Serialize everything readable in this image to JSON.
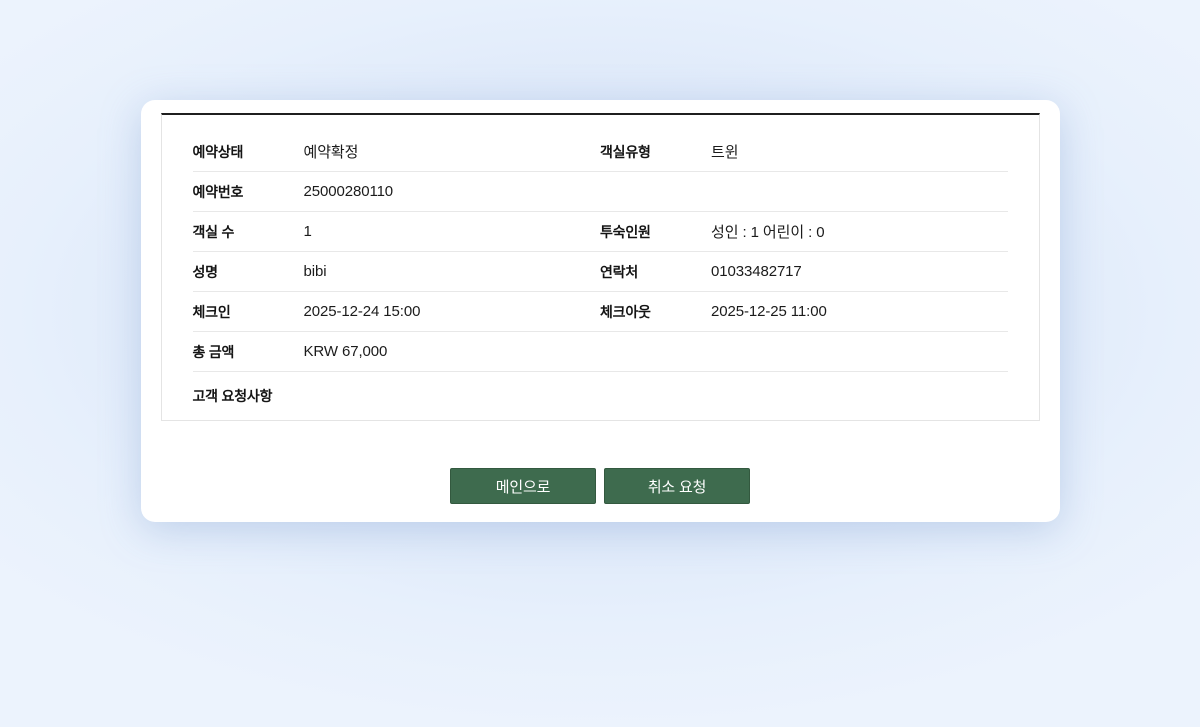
{
  "colors": {
    "background": "#e7f0fc",
    "background_glow": "#d4e2f5",
    "card": "#ffffff",
    "table_top_border": "#1f1f1f",
    "divider": "#e8e8e8",
    "button_green": "#3e6b4e",
    "button_text": "#ffffff"
  },
  "reservation": {
    "rows": [
      {
        "cells": [
          {
            "label": "예약상태",
            "value": "예약확정"
          },
          {
            "label": "객실유형",
            "value": "트윈"
          }
        ]
      },
      {
        "cells": [
          {
            "label": "예약번호",
            "value": "25000280110"
          }
        ]
      },
      {
        "cells": [
          {
            "label": "객실 수",
            "value": "1"
          },
          {
            "label": "투숙인원",
            "value": "성인 : 1 어린이 : 0"
          }
        ]
      },
      {
        "cells": [
          {
            "label": "성명",
            "value": "bibi"
          },
          {
            "label": "연락처",
            "value": "01033482717"
          }
        ]
      },
      {
        "cells": [
          {
            "label": "체크인",
            "value": "2025-12-24 15:00"
          },
          {
            "label": "체크아웃",
            "value": "2025-12-25 11:00"
          }
        ]
      },
      {
        "cells": [
          {
            "label": "총 금액",
            "value": "KRW 67,000"
          }
        ]
      },
      {
        "cells": [
          {
            "label": "고객 요청사항",
            "value": ""
          }
        ]
      }
    ],
    "buttons": {
      "main": "메인으로",
      "cancel": "취소 요청"
    }
  }
}
